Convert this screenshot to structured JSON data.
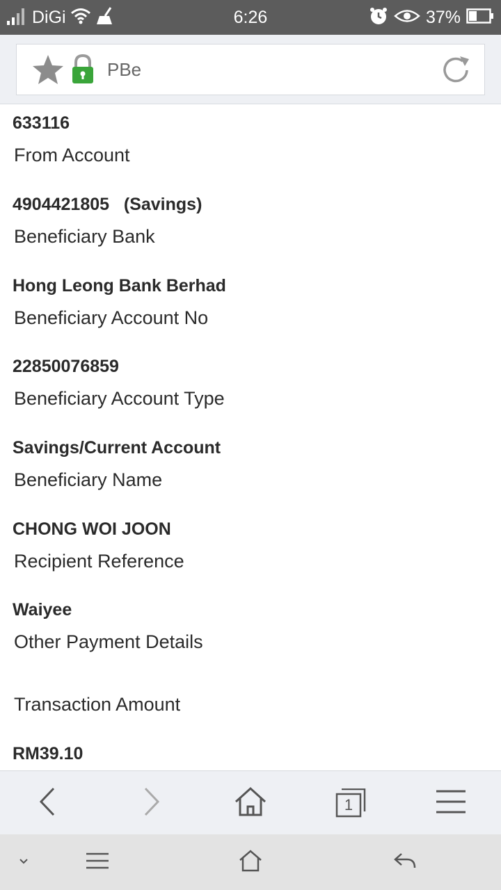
{
  "status_bar": {
    "carrier": "DiGi",
    "time": "6:26",
    "battery": "37%",
    "icons": [
      "signal-icon",
      "wifi-icon",
      "cleaner-icon",
      "alarm-icon",
      "eye-icon",
      "battery-icon"
    ]
  },
  "address_bar": {
    "url": "PBe",
    "icons": [
      "star-icon",
      "lock-icon",
      "reload-icon"
    ]
  },
  "details": [
    {
      "kind": "value",
      "text": "633116"
    },
    {
      "kind": "label",
      "text": "From Account"
    },
    {
      "kind": "value",
      "text": "4904421805   (Savings)"
    },
    {
      "kind": "label",
      "text": "Beneficiary Bank"
    },
    {
      "kind": "value",
      "text": "Hong Leong Bank Berhad"
    },
    {
      "kind": "label",
      "text": "Beneficiary Account No"
    },
    {
      "kind": "value",
      "text": "22850076859"
    },
    {
      "kind": "label",
      "text": "Beneficiary Account Type"
    },
    {
      "kind": "value",
      "text": "Savings/Current Account"
    },
    {
      "kind": "label",
      "text": "Beneficiary Name"
    },
    {
      "kind": "value",
      "text": "CHONG WOI JOON"
    },
    {
      "kind": "label",
      "text": "Recipient Reference"
    },
    {
      "kind": "value",
      "text": "Waiyee"
    },
    {
      "kind": "label",
      "text": "Other Payment Details"
    },
    {
      "kind": "label",
      "text": "Transaction Amount"
    },
    {
      "kind": "value",
      "text": "RM39.10"
    }
  ],
  "toolbar": {
    "tab_count": "1",
    "icons": [
      "back-icon",
      "forward-icon",
      "home-icon",
      "tabs-icon",
      "menu-icon"
    ]
  },
  "navbar": {
    "icons": [
      "chevron-down-icon",
      "menu-icon",
      "home-icon",
      "return-icon"
    ]
  },
  "colors": {
    "status_bar_bg": "#5c5c5c",
    "lock_green": "#3aa53a",
    "chrome_bg": "#eef0f4",
    "text": "#2a2a2a"
  }
}
